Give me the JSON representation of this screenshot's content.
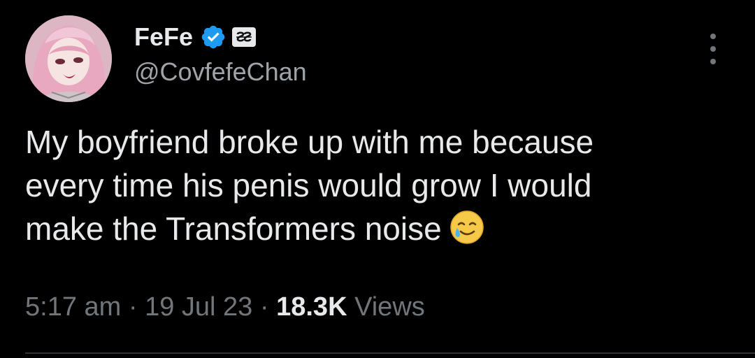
{
  "author": {
    "display_name": "FeFe",
    "handle": "@CovfefeChan",
    "verified_icon": "verified-check-icon",
    "badge_icon": "subscriber-badge-icon"
  },
  "tweet": {
    "text_lines": [
      "My boyfriend broke up with me because",
      "every time his penis would grow I would",
      "make the Transformers noise"
    ],
    "emoji": "smiling-face-with-tear-icon"
  },
  "meta": {
    "time": "5:17 am",
    "separator": "·",
    "date": "19 Jul 23",
    "views_count": "18.3K",
    "views_label": "Views"
  },
  "colors": {
    "background": "#000000",
    "text": "#e7e9ea",
    "secondary": "#71767b",
    "verified": "#1d9bf0"
  }
}
